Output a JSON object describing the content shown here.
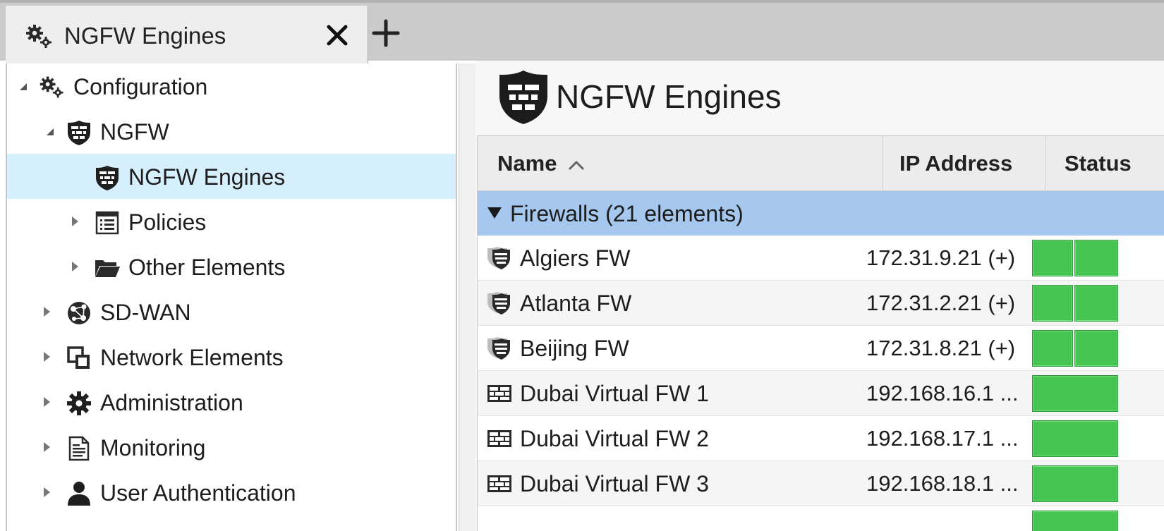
{
  "tabs": [
    {
      "label": "NGFW Engines",
      "icon": "gears-icon",
      "active": true
    }
  ],
  "tree": {
    "items": [
      {
        "label": "Configuration",
        "icon": "gears-icon",
        "expanded": true
      },
      {
        "label": "NGFW",
        "icon": "shield-firewall-icon",
        "expanded": true
      },
      {
        "label": "NGFW Engines",
        "icon": "shield-firewall-icon",
        "selected": true
      },
      {
        "label": "Policies",
        "icon": "list-document-icon",
        "expanded": false
      },
      {
        "label": "Other Elements",
        "icon": "folder-open-icon",
        "expanded": false
      },
      {
        "label": "SD-WAN",
        "icon": "globe-network-icon",
        "expanded": false
      },
      {
        "label": "Network Elements",
        "icon": "overlapping-squares-icon",
        "expanded": false
      },
      {
        "label": "Administration",
        "icon": "gear-icon",
        "expanded": false
      },
      {
        "label": "Monitoring",
        "icon": "report-document-icon",
        "expanded": false
      },
      {
        "label": "User Authentication",
        "icon": "user-icon",
        "expanded": false
      }
    ]
  },
  "main": {
    "title": "NGFW Engines",
    "title_icon": "shield-firewall-icon",
    "columns": {
      "name": "Name",
      "ip": "IP Address",
      "status": "Status"
    },
    "sort": {
      "column": "Name",
      "direction": "ascending"
    },
    "group": {
      "label": "Firewalls (21 elements)",
      "expanded": true
    },
    "rows": [
      {
        "name": "Algiers FW",
        "ip": "172.31.9.21 (+)",
        "icon": "cluster-firewall-icon",
        "status": [
          "online",
          "online"
        ]
      },
      {
        "name": "Atlanta FW",
        "ip": "172.31.2.21 (+)",
        "icon": "cluster-firewall-icon",
        "status": [
          "online",
          "online"
        ]
      },
      {
        "name": "Beijing FW",
        "ip": "172.31.8.21 (+)",
        "icon": "cluster-firewall-icon",
        "status": [
          "online",
          "online"
        ]
      },
      {
        "name": "Dubai Virtual FW 1",
        "ip": "192.168.16.1 ...",
        "icon": "virtual-firewall-icon",
        "status": [
          "online"
        ]
      },
      {
        "name": "Dubai Virtual FW 2",
        "ip": "192.168.17.1 ...",
        "icon": "virtual-firewall-icon",
        "status": [
          "online"
        ]
      },
      {
        "name": "Dubai Virtual FW 3",
        "ip": "192.168.18.1 ...",
        "icon": "virtual-firewall-icon",
        "status": [
          "online"
        ]
      }
    ]
  },
  "colors": {
    "selected_row": "#d6effc",
    "group_row": "#a6c8ee",
    "status_online": "#46c553"
  }
}
